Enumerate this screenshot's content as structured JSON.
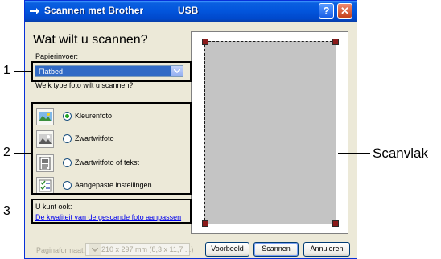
{
  "window": {
    "title": "Scannen met Brother",
    "subtitle": "USB",
    "help_label": "?",
    "close_label": "✕"
  },
  "heading": "Wat wilt u scannen?",
  "source": {
    "label": "Papierinvoer:",
    "value": "Flatbed"
  },
  "photo_type": {
    "label": "Welk type foto wilt u scannen?",
    "options": [
      {
        "label": "Kleurenfoto",
        "selected": true,
        "icon": "color-photo-icon"
      },
      {
        "label": "Zwartwitfoto",
        "selected": false,
        "icon": "bw-photo-icon"
      },
      {
        "label": "Zwartwitfoto of tekst",
        "selected": false,
        "icon": "bw-text-icon"
      },
      {
        "label": "Aangepaste instellingen",
        "selected": false,
        "icon": "custom-settings-icon"
      }
    ]
  },
  "extra": {
    "label": "U kunt ook:",
    "link": "De kwaliteit van de gescande foto aanpassen"
  },
  "page_size": {
    "label": "Paginaformaat:",
    "value": "A4: 210 x 297 mm (8,3 x 11,7 ...)"
  },
  "buttons": {
    "preview": "Voorbeeld",
    "scan": "Scannen",
    "cancel": "Annuleren"
  },
  "callouts": {
    "one": "1",
    "two": "2",
    "three": "3",
    "scan_area": "Scanvlak"
  },
  "colors": {
    "titlebar": "#0255dc",
    "dialog_bg": "#ece9d8",
    "selection": "#316ac5",
    "handle": "#8b1a1a",
    "link": "#0000ee"
  }
}
